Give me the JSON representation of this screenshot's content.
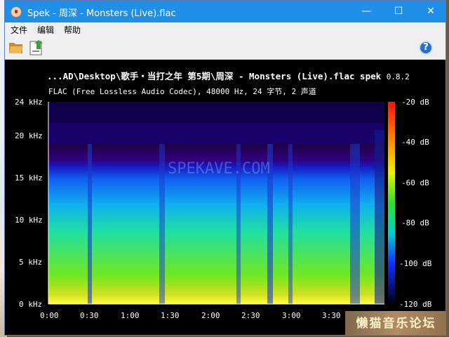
{
  "window": {
    "title": "Spek - 周深 - Monsters (Live).flac",
    "controls": {
      "minimize": "—",
      "maximize": "☐",
      "close": "✕"
    }
  },
  "menu": [
    "文件",
    "编辑",
    "帮助"
  ],
  "toolbar": {
    "open_icon": "folder-open-icon",
    "save_icon": "save-arrow-icon",
    "help_icon": "help-icon",
    "help_glyph": "?"
  },
  "spectrogram": {
    "heading": "...AD\\Desktop\\歌手・当打之年 第5期\\周深 - Monsters (Live).flac  spek",
    "version": "0.8.2",
    "format": "FLAC (Free Lossless Audio Codec), 48000 Hz, 24 字节, 2 声道",
    "freq_ticks": [
      "24 kHz",
      "20 kHz",
      "15 kHz",
      "10 kHz",
      "5 kHz",
      "0 kHz"
    ],
    "time_ticks": [
      "0:00",
      "0:30",
      "1:00",
      "1:30",
      "2:00",
      "2:30",
      "3:00",
      "3:30"
    ],
    "db_ticks": [
      "-20 dB",
      "-40 dB",
      "-60 dB",
      "-80 dB",
      "-100 dB",
      "-120 dB"
    ],
    "watermark_faint": "SPEKAVE.COM"
  },
  "forum_watermark": "懒猫音乐论坛",
  "colors": {
    "titlebar": "#1f8fe8",
    "background": "#000000"
  }
}
